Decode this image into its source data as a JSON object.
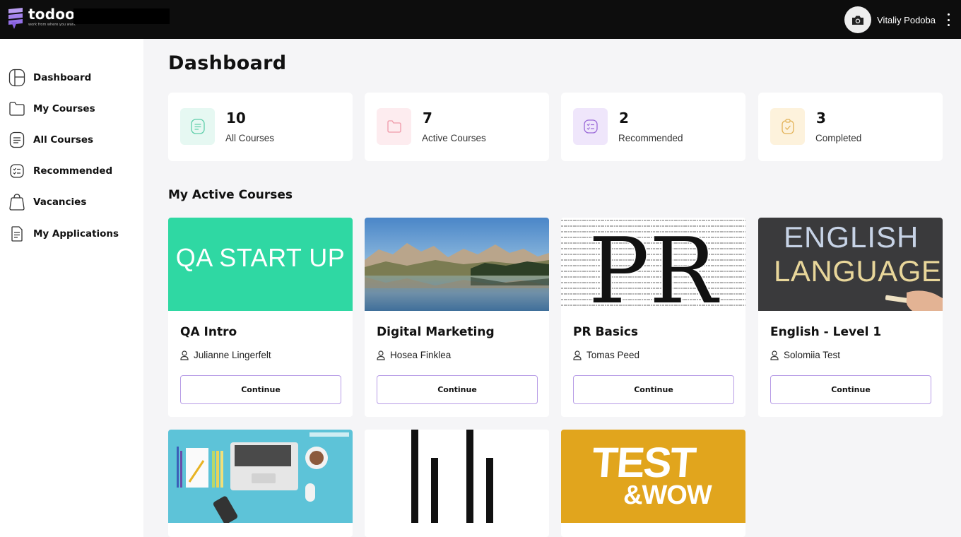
{
  "app": {
    "name": "todoo",
    "tagline": "work from where you want"
  },
  "user": {
    "name": "Vitaliy Podoba"
  },
  "sidebar": {
    "items": [
      {
        "label": "Dashboard",
        "icon": "dashboard-icon"
      },
      {
        "label": "My Courses",
        "icon": "folder-icon"
      },
      {
        "label": "All Courses",
        "icon": "document-icon"
      },
      {
        "label": "Recommended",
        "icon": "checklist-icon"
      },
      {
        "label": "Vacancies",
        "icon": "bag-icon"
      },
      {
        "label": "My Applications",
        "icon": "application-icon"
      }
    ]
  },
  "main": {
    "title": "Dashboard",
    "stats": [
      {
        "value": "10",
        "label": "All Courses",
        "icon": "document-icon",
        "color": "#e6f8f2",
        "icon_color": "#5fcfaa"
      },
      {
        "value": "7",
        "label": "Active Courses",
        "icon": "folder-icon",
        "color": "#fdecef",
        "icon_color": "#f09aa9"
      },
      {
        "value": "2",
        "label": "Recommended",
        "icon": "checklist-icon",
        "color": "#efe6fb",
        "icon_color": "#9b6ad8"
      },
      {
        "value": "3",
        "label": "Completed",
        "icon": "clipboard-check-icon",
        "color": "#fdf2dc",
        "icon_color": "#e3b257"
      }
    ],
    "section_title": "My Active Courses",
    "courses": [
      {
        "title": "QA Intro",
        "author": "Julianne Lingerfelt",
        "button": "Continue",
        "thumb_text": "QA START UP"
      },
      {
        "title": "Digital Marketing",
        "author": "Hosea Finklea",
        "button": "Continue"
      },
      {
        "title": "PR Basics",
        "author": "Tomas Peed",
        "button": "Continue",
        "thumb_text": "PR"
      },
      {
        "title": "English - Level 1",
        "author": "Solomiia Test",
        "button": "Continue",
        "thumb_text_1": "ENGLISH",
        "thumb_text_2": "LANGUAGE"
      }
    ],
    "more_courses": [
      {
        "thumb": "workspace-illustration"
      },
      {
        "thumb": "bars-logo"
      },
      {
        "thumb_text_1": "TEST",
        "thumb_text_2": "&WOW"
      }
    ]
  }
}
